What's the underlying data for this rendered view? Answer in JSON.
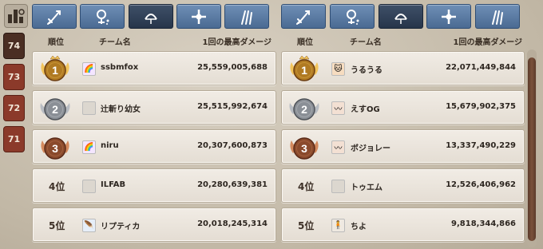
{
  "season_tabs": [
    {
      "label": "74",
      "active": true
    },
    {
      "label": "73",
      "active": false
    },
    {
      "label": "72",
      "active": false
    },
    {
      "label": "71",
      "active": false
    }
  ],
  "class_tabs": [
    {
      "icon": "sword-icon",
      "active": false
    },
    {
      "icon": "magic-icon",
      "active": false
    },
    {
      "icon": "bow-icon",
      "active": true
    },
    {
      "icon": "cross-shield-icon",
      "active": false
    },
    {
      "icon": "claw-icon",
      "active": false
    }
  ],
  "columns": {
    "rank": "順位",
    "team": "チーム名",
    "damage": "1回の最高ダメージ"
  },
  "left_ranking": [
    {
      "rank": "1",
      "medal": "gold",
      "team": "ssbmfox",
      "avatar": "rainbow-icon",
      "damage": "25,559,005,688"
    },
    {
      "rank": "2",
      "medal": "silver",
      "team": "辻斬り幼女",
      "avatar": "blank-icon",
      "damage": "25,515,992,674"
    },
    {
      "rank": "3",
      "medal": "bronze",
      "team": "niru",
      "avatar": "rainbow-icon",
      "damage": "20,307,600,873"
    },
    {
      "rank": "4位",
      "medal": "",
      "team": "ILFAB",
      "avatar": "blank-icon",
      "damage": "20,280,639,381"
    },
    {
      "rank": "5位",
      "medal": "",
      "team": "リプティカ",
      "avatar": "feather-icon",
      "damage": "20,018,245,314"
    }
  ],
  "right_ranking": [
    {
      "rank": "1",
      "medal": "gold",
      "team": "うるうる",
      "avatar": "cat-icon",
      "damage": "22,071,449,844"
    },
    {
      "rank": "2",
      "medal": "silver",
      "team": "えすOG",
      "avatar": "wing-icon",
      "damage": "15,679,902,375"
    },
    {
      "rank": "3",
      "medal": "bronze",
      "team": "ボジョレー",
      "avatar": "wing-icon",
      "damage": "13,337,490,229"
    },
    {
      "rank": "4位",
      "medal": "",
      "team": "トゥエム",
      "avatar": "blank-icon",
      "damage": "12,526,406,962"
    },
    {
      "rank": "5位",
      "medal": "",
      "team": "ちよ",
      "avatar": "figure-icon",
      "damage": "9,818,344,866"
    }
  ],
  "colors": {
    "gold": "#c8902e",
    "silver": "#7a7f86",
    "bronze": "#8b4a2f",
    "tab_blue": "#5a7aa3",
    "season_red": "#8b3a2a"
  }
}
